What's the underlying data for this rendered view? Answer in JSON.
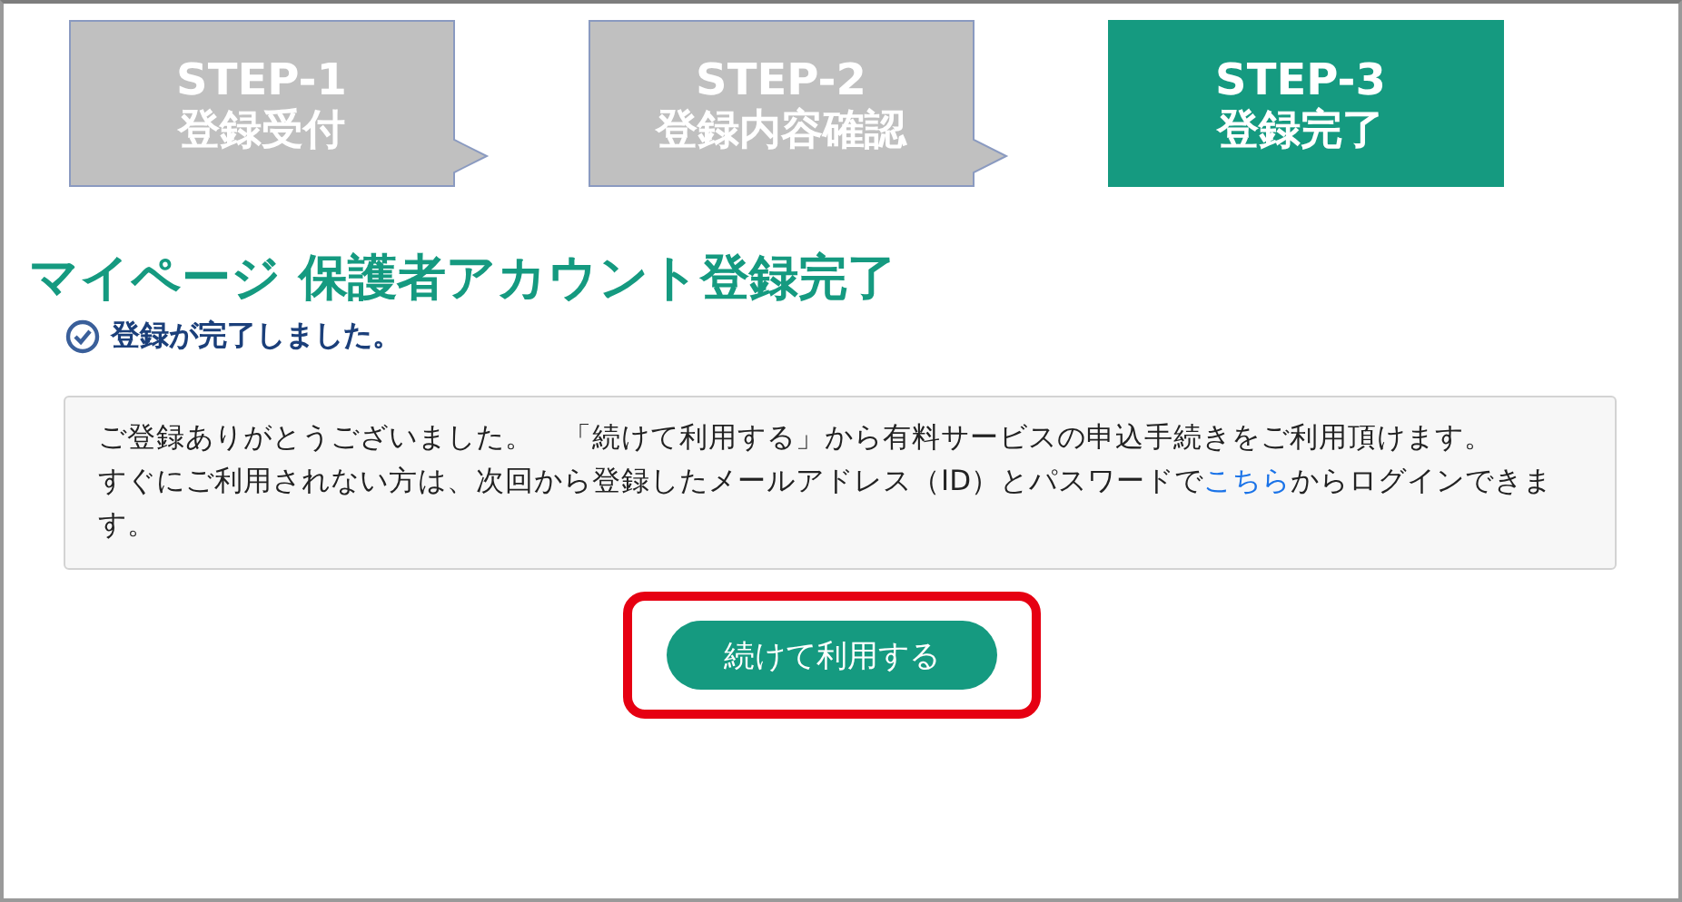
{
  "steps": [
    {
      "number": "STEP-1",
      "label": "登録受付",
      "selected": false
    },
    {
      "number": "STEP-2",
      "label": "登録内容確認",
      "selected": false
    },
    {
      "number": "STEP-3",
      "label": "登録完了",
      "selected": true
    }
  ],
  "title": "マイページ 保護者アカウント登録完了",
  "status": "登録が完了しました。",
  "message": [
    {
      "before": "ご登録ありがとうございました。　「続けて利用する」から有料サービスの申込手続きをご利用頂けます。"
    },
    {
      "before": "すぐにご利用されない方は、次回から登録したメールアドレス（ID）とパスワードで",
      "link": "こちら",
      "after": "からログインできます。"
    }
  ],
  "button": {
    "label": "続けて利用する",
    "highlighted": true
  }
}
